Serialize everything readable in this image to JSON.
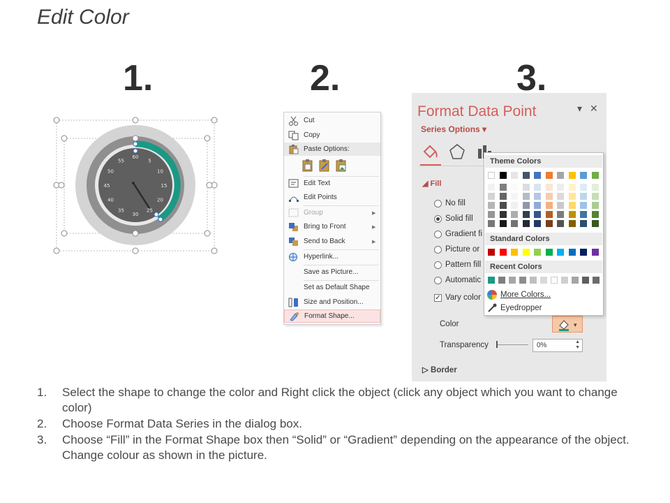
{
  "title": "Edit Color",
  "steps": [
    "1.",
    "2.",
    "3."
  ],
  "gauge": {
    "ticks": [
      "55",
      "60",
      "5",
      "10",
      "15",
      "20",
      "25",
      "30",
      "35",
      "40",
      "45",
      "50"
    ],
    "colors": {
      "accent": "#1a9985",
      "outer": "#cfcfcf",
      "ring": "#8c8c8c",
      "face": "#5f5f5f",
      "dial": "#e6e6e6"
    }
  },
  "context_menu": {
    "items": [
      {
        "label": "Cut",
        "icon": "scissors-icon",
        "state": "normal"
      },
      {
        "label": "Copy",
        "icon": "copy-icon",
        "state": "normal"
      },
      {
        "label": "Paste Options:",
        "icon": "paste-icon",
        "state": "header"
      },
      {
        "label": "Edit Text",
        "icon": "edit-text-icon",
        "state": "normal"
      },
      {
        "label": "Edit Points",
        "icon": "edit-points-icon",
        "state": "normal"
      },
      {
        "label": "Group",
        "icon": "group-icon",
        "state": "disabled"
      },
      {
        "label": "Bring to Front",
        "icon": "bring-to-front-icon",
        "state": "normal"
      },
      {
        "label": "Send to Back",
        "icon": "send-to-back-icon",
        "state": "normal"
      },
      {
        "label": "Hyperlink...",
        "icon": "hyperlink-icon",
        "state": "normal"
      },
      {
        "label": "Save as Picture...",
        "icon": "",
        "state": "normal"
      },
      {
        "label": "Set as Default Shape",
        "icon": "",
        "state": "normal"
      },
      {
        "label": "Size and Position...",
        "icon": "size-position-icon",
        "state": "normal"
      },
      {
        "label": "Format Shape...",
        "icon": "format-shape-icon",
        "state": "highlighted"
      }
    ]
  },
  "format_pane": {
    "title": "Format Data Point",
    "series_options": "Series Options",
    "fill_header": "Fill",
    "fill_options": [
      {
        "label": "No fill",
        "type": "radio",
        "selected": false
      },
      {
        "label": "Solid fill",
        "type": "radio",
        "selected": true
      },
      {
        "label": "Gradient fi",
        "type": "radio",
        "selected": false
      },
      {
        "label": "Picture or",
        "type": "radio",
        "selected": false
      },
      {
        "label": "Pattern fill",
        "type": "radio",
        "selected": false
      },
      {
        "label": "Automatic",
        "type": "radio",
        "selected": false
      },
      {
        "label": "Vary color",
        "type": "checkbox",
        "selected": true
      }
    ],
    "color_label": "Color",
    "transparency_label": "Transparency",
    "transparency_value": "0%",
    "border_header": "Border",
    "accent_color": "#d2605b"
  },
  "color_picker": {
    "theme_colors_label": "Theme Colors",
    "standard_colors_label": "Standard Colors",
    "recent_colors_label": "Recent Colors",
    "more_colors_label": "More Colors...",
    "eyedropper_label": "Eyedropper",
    "theme_top": [
      "#ffffff",
      "#000000",
      "#e7e6e6",
      "#44546a",
      "#4472c4",
      "#ed7d31",
      "#a5a5a5",
      "#ffc000",
      "#5b9bd5",
      "#70ad47"
    ],
    "standard": [
      "#c00000",
      "#ff0000",
      "#ffc000",
      "#ffff00",
      "#92d050",
      "#00b050",
      "#00b0f0",
      "#0070c0",
      "#002060",
      "#7030a0"
    ],
    "recent": [
      "#1a9985",
      "#7f7f7f",
      "#a6a6a6",
      "#8c8c8c",
      "#bfbfbf",
      "#d9d9d9",
      "#ffffff",
      "#cfcfcf",
      "#a5a5a5",
      "#5f5f5f",
      "#6b6b6b"
    ]
  },
  "instructions": [
    {
      "num": "1.",
      "text": "Select the shape to change the color and Right click the object (click any object which you want to change color)"
    },
    {
      "num": "2.",
      "text": "Choose Format Data Series in the dialog box."
    },
    {
      "num": "3.",
      "text": "Choose “Fill” in the Format Shape box then “Solid” or “Gradient” depending on the appearance of the object. Change colour as shown in the picture."
    }
  ]
}
